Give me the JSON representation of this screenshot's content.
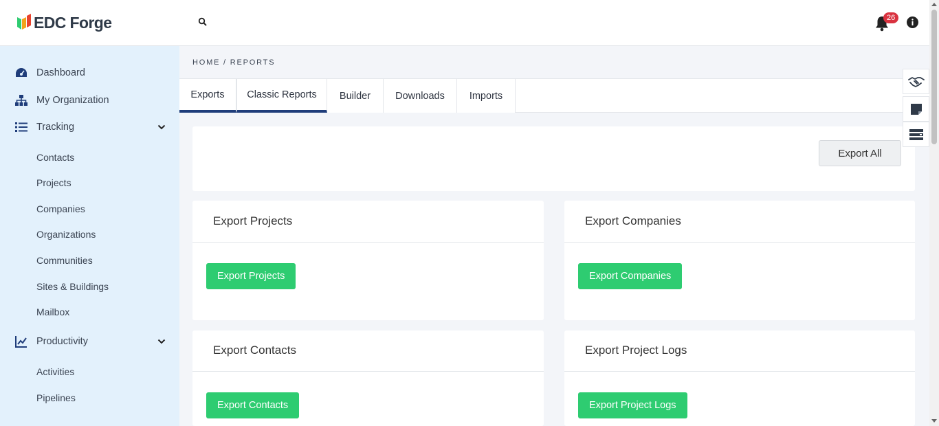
{
  "header": {
    "logo_text": "EDC Forge",
    "notification_count": "26"
  },
  "sidebar": {
    "top_items": [
      {
        "label": "Dashboard",
        "icon": "dashboard-gauge-icon"
      },
      {
        "label": "My Organization",
        "icon": "org-chart-icon"
      },
      {
        "label": "Tracking",
        "icon": "list-icon",
        "expanded": true
      }
    ],
    "tracking_items": [
      "Contacts",
      "Projects",
      "Companies",
      "Organizations",
      "Communities",
      "Sites & Buildings",
      "Mailbox"
    ],
    "productivity": {
      "label": "Productivity",
      "icon": "line-chart-icon",
      "expanded": true
    },
    "productivity_items": [
      "Activities",
      "Pipelines"
    ]
  },
  "breadcrumb": "HOME / REPORTS",
  "tabs": [
    "Exports",
    "Classic Reports",
    "Builder",
    "Downloads",
    "Imports"
  ],
  "active_tabs": [
    "Exports",
    "Classic Reports"
  ],
  "export_all_label": "Export All",
  "cards": [
    {
      "title": "Export Projects",
      "button": "Export Projects"
    },
    {
      "title": "Export Companies",
      "button": "Export Companies"
    },
    {
      "title": "Export Contacts",
      "button": "Export Contacts"
    },
    {
      "title": "Export Project Logs",
      "button": "Export Project Logs"
    }
  ],
  "colors": {
    "sidebar_bg": "#e3f1fc",
    "accent_green": "#2ecc71",
    "tab_active": "#1f3d7a",
    "badge_red": "#d9323f",
    "nav_icon": "#1f3d7a"
  }
}
